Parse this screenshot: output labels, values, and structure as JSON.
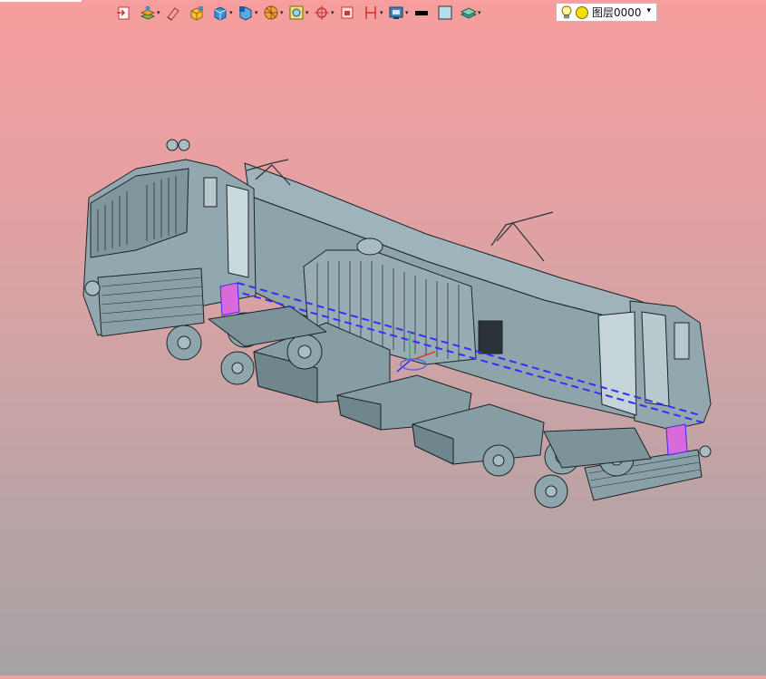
{
  "toolbar": {
    "items": [
      {
        "icon": "import-icon",
        "dropdown": false
      },
      {
        "icon": "layers-icon",
        "dropdown": true
      },
      {
        "icon": "eraser-icon",
        "dropdown": false
      },
      {
        "icon": "box-edit-icon",
        "dropdown": false
      },
      {
        "icon": "cube-icon",
        "dropdown": true
      },
      {
        "icon": "render-cube-icon",
        "dropdown": true
      },
      {
        "icon": "section-icon",
        "dropdown": true
      },
      {
        "icon": "frame-icon",
        "dropdown": true
      },
      {
        "icon": "snap-icon",
        "dropdown": true
      },
      {
        "icon": "view-window-icon",
        "dropdown": false
      },
      {
        "icon": "dimension-icon",
        "dropdown": true
      },
      {
        "icon": "display-mode-icon",
        "dropdown": true
      },
      {
        "icon": "line-color-icon",
        "dropdown": false
      },
      {
        "icon": "fill-color-icon",
        "dropdown": false
      },
      {
        "icon": "layer-stack-icon",
        "dropdown": true
      }
    ]
  },
  "layer_selector": {
    "label": "图层0000",
    "bulb_icon": "light-bulb-icon",
    "visibility_icon": "sun-icon",
    "caret": "▾"
  },
  "viewport": {
    "model": "electric-locomotive-3d-model",
    "colors": {
      "background_top": "#f79e9e",
      "background_bottom": "#a8a3a3",
      "model_body": "#8ea4ab",
      "model_shadow": "#6f868d",
      "outline": "#1c2428",
      "selection": "#3a2cff",
      "highlight": "#d96ad9"
    }
  }
}
